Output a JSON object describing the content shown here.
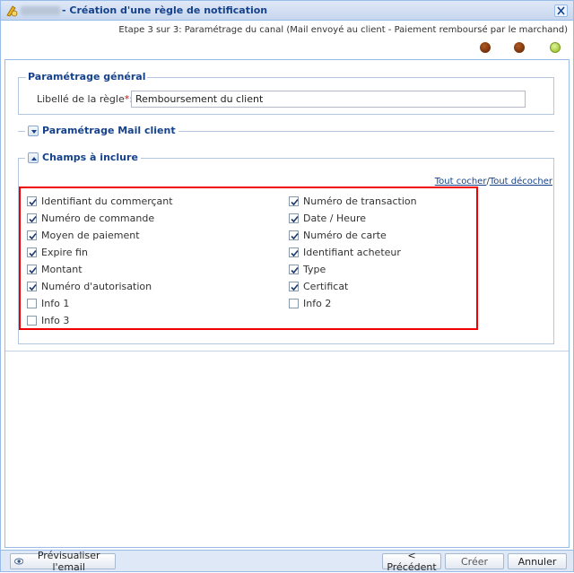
{
  "window": {
    "title": "- Création d'une règle de notification"
  },
  "step": {
    "text": "Etape 3 sur 3: Paramétrage du canal (Mail envoyé au client - Paiement remboursé par le marchand)"
  },
  "general": {
    "legend": "Paramétrage général",
    "label": "Libellé de la règle",
    "required": "*:",
    "value": "Remboursement du client"
  },
  "mail": {
    "title": "Paramétrage Mail client"
  },
  "fields": {
    "title": "Champs à inclure",
    "check_all": "Tout cocher",
    "separator": "/",
    "uncheck_all": "Tout décocher",
    "left": [
      {
        "label": "Identifiant du commerçant",
        "checked": true
      },
      {
        "label": "Numéro de commande",
        "checked": true
      },
      {
        "label": "Moyen de paiement",
        "checked": true
      },
      {
        "label": "Expire fin",
        "checked": true
      },
      {
        "label": "Montant",
        "checked": true
      },
      {
        "label": "Numéro d'autorisation",
        "checked": true
      },
      {
        "label": "Info 1",
        "checked": false
      },
      {
        "label": "Info 3",
        "checked": false
      }
    ],
    "right": [
      {
        "label": "Numéro de transaction",
        "checked": true
      },
      {
        "label": "Date / Heure",
        "checked": true
      },
      {
        "label": "Numéro de carte",
        "checked": true
      },
      {
        "label": "Identifiant acheteur",
        "checked": true
      },
      {
        "label": "Type",
        "checked": true
      },
      {
        "label": "Certificat",
        "checked": true
      },
      {
        "label": "Info 2",
        "checked": false
      }
    ]
  },
  "buttons": {
    "preview": "Prévisualiser l'email",
    "previous": "< Précédent",
    "create": "Créer",
    "cancel": "Annuler"
  },
  "colors": {
    "accent": "#15428b",
    "highlight_box": "#ee0000",
    "step_done": "#7a2e0c",
    "step_current": "#b4d848"
  }
}
